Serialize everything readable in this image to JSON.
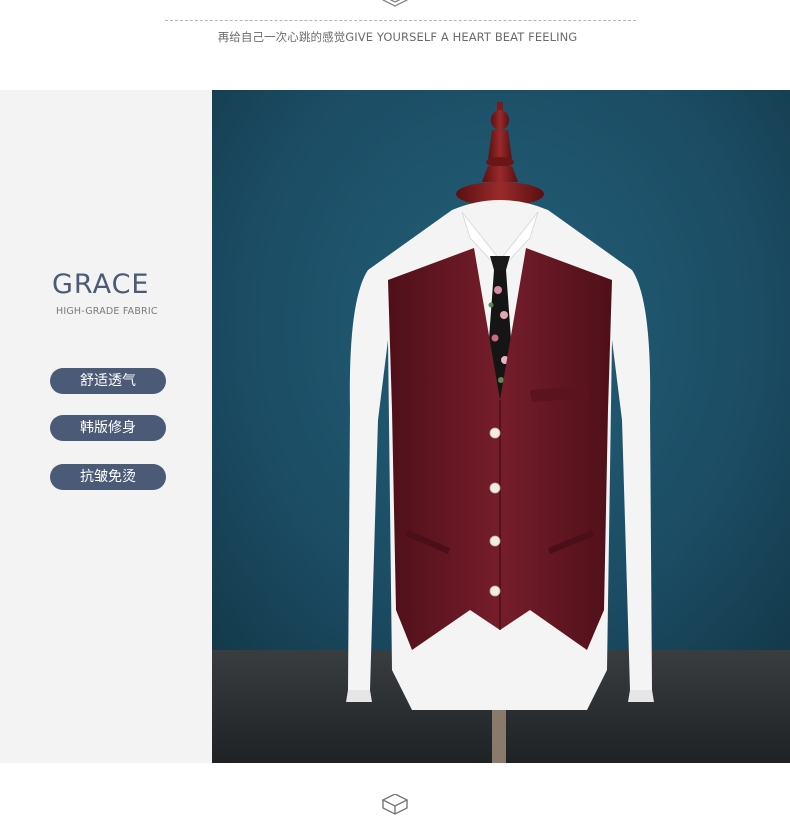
{
  "header": {
    "tagline": "再给自己一次心跳的感觉GIVE YOURSELF A HEART BEAT FEELING",
    "icon": "box-icon"
  },
  "sidebar": {
    "brand": "GRACE",
    "subtitle": "HIGH-GRADE FABRIC",
    "features": [
      "舒适透气",
      "韩版修身",
      "抗皱免烫"
    ]
  },
  "product": {
    "description": "burgundy waistcoat over white shirt with floral tie on mannequin",
    "colors": {
      "background": "#1d4f66",
      "vest": "#6e1a26",
      "accent": "#4b5a76"
    }
  },
  "footer": {
    "icon": "box-icon"
  }
}
